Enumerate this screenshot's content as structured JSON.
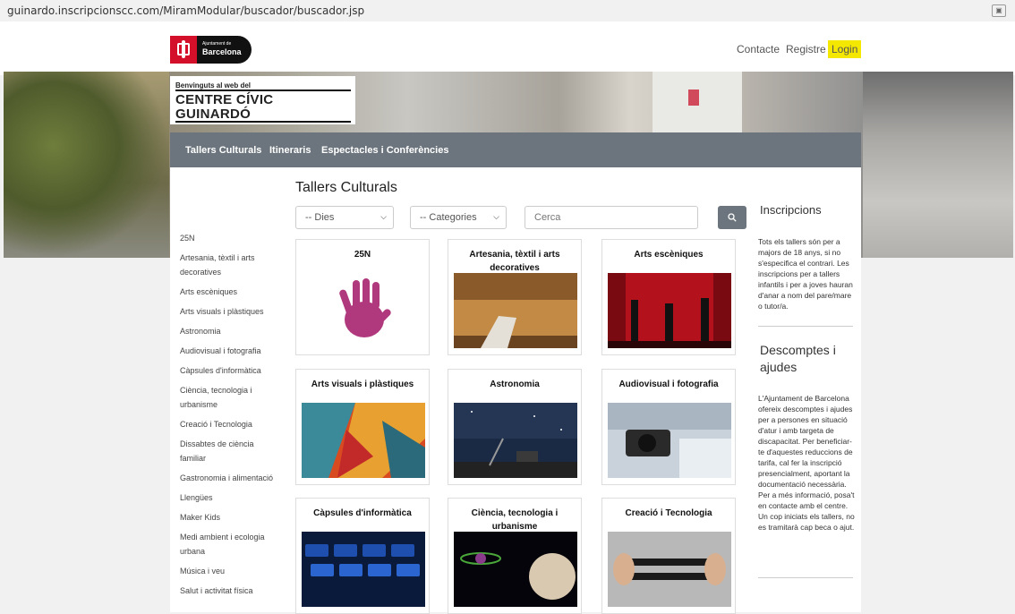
{
  "browser": {
    "url": "guinardo.inscripcionscc.com/MiramModular/buscador/buscador.jsp"
  },
  "header": {
    "logo": {
      "line1": "Ajuntament de",
      "line2": "Barcelona"
    },
    "nav": {
      "contacte": "Contacte",
      "registre": "Registre",
      "login": "Login"
    }
  },
  "banner": {
    "welcome": "Benvinguts al web del",
    "name_line1": "CENTRE CÍVIC",
    "name_line2": "GUINARDÓ"
  },
  "menu": {
    "items": [
      "Tallers Culturals",
      "Itineraris",
      "Espectacles i Conferències"
    ]
  },
  "main": {
    "title": "Tallers Culturals",
    "filters": {
      "dies": "-- Dies",
      "categories": "-- Categories",
      "search_placeholder": "Cerca"
    }
  },
  "sidebar": {
    "categories": [
      "25N",
      "Artesania, tèxtil i arts decoratives",
      "Arts escèniques",
      "Arts visuals i plàstiques",
      "Astronomia",
      "Audiovisual i fotografia",
      "Càpsules d'informàtica",
      "Ciència, tecnologia i urbanisme",
      "Creació i Tecnologia",
      "Dissabtes de ciència familiar",
      "Gastronomia i alimentació",
      "Llengües",
      "Maker Kids",
      "Medi ambient i ecologia urbana",
      "Música i veu",
      "Salut i activitat física"
    ]
  },
  "cards": [
    {
      "title": "25N",
      "image": "purple-handprint"
    },
    {
      "title": "Artesania, tèxtil i arts decoratives",
      "image": "wooden-drawer"
    },
    {
      "title": "Arts escèniques",
      "image": "stage-dancers"
    },
    {
      "title": "Arts visuals i plàstiques",
      "image": "colorful-abstract"
    },
    {
      "title": "Astronomia",
      "image": "night-sky-telescope"
    },
    {
      "title": "Audiovisual i fotografia",
      "image": "camera-laptop"
    },
    {
      "title": "Càpsules d'informàtica",
      "image": "keyboard-blue"
    },
    {
      "title": "Ciència, tecnologia i urbanisme",
      "image": "space-planet"
    },
    {
      "title": "Creació i Tecnologia",
      "image": "hands-wires"
    }
  ],
  "right_sidebar": {
    "inscripcions_title": "Inscripcions",
    "inscripcions_text": "Tots els tallers són per a majors de 18 anys, si no s'especifica el contrari. Les inscripcions per a tallers infantils i per a joves hauran d'anar a nom del pare/mare o tutor/a.",
    "descomptes_title": "Descomptes i ajudes",
    "descomptes_text": "L'Ajuntament de Barcelona ofereix descomptes i ajudes per a persones en situació d'atur i amb targeta de discapacitat. Per beneficiar-te d'aquestes reduccions de tarifa, cal fer la inscripció presencialment, aportant la documentació necessària. Per a més informació, posa't en contacte amb el centre. Un cop iniciats els tallers, no es tramitarà cap beca o ajut."
  },
  "colors": {
    "accent_login": "#f5e800",
    "menubar": "#6c757d",
    "brand_red": "#d40f2a"
  }
}
